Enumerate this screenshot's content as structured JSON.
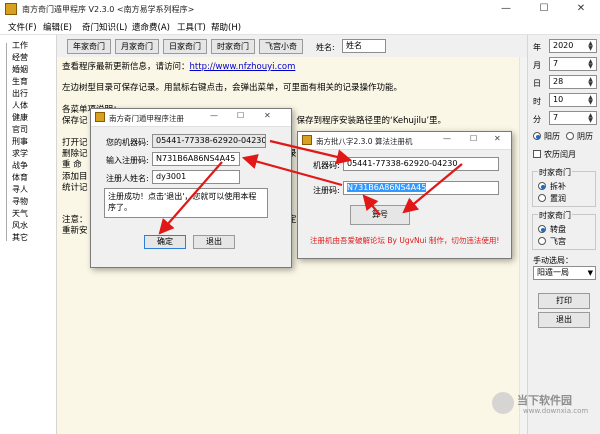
{
  "window": {
    "title": "南方奇门遁甲程序 V2.3.0   <南方易学系列程序>",
    "minimize": "—",
    "maximize": "☐",
    "close": "✕"
  },
  "menu": [
    "文件(F)",
    "编辑(E)",
    "奇门知识(L)",
    "遗命费(A)",
    "工具(T)",
    "帮助(H)"
  ],
  "toolbar": {
    "buttons": [
      "年家奇门",
      "月家奇门",
      "日家奇门",
      "时家奇门",
      "飞宫小奇"
    ],
    "name_label": "姓名:",
    "name_value": "姓名"
  },
  "tree": [
    "工作",
    "经营",
    "婚姻",
    "生育",
    "出行",
    "人体",
    "健康",
    "官司",
    "刑事",
    "求学",
    "战争",
    "体育",
    "寻人",
    "寻物",
    "天气",
    "风水",
    "其它"
  ],
  "content": {
    "line1_text": "查看程序最新更新信息，请访问：",
    "line1_link": "http://www.nfzhouyi.com",
    "line2": "左边树型目录可保存记录。用鼠标右键点击，会弹出菜单，可里面有相关的记录操作功能。",
    "line3": "各菜单项说明：",
    "line4a": "保存记",
    "line4b": "）保存到程序安装路径里的‘Kehujilu’里。",
    "line5": "打开记",
    "line6a": "删除记",
    "line6b": "录，",
    "line7": "重 命",
    "line8": "添加目",
    "line9": "统计记",
    "line10a": "注意：",
    "line10b": "定期",
    "line11a": "重新安",
    "line11b": "。"
  },
  "right_panel": {
    "year_label": "年",
    "year_value": "2020",
    "month_label": "月",
    "month_value": "7",
    "day_label": "日",
    "day_value": "28",
    "hour_label": "时",
    "hour_value": "10",
    "minute_label": "分",
    "minute_value": "7",
    "solar": "阳历",
    "lunar": "阴历",
    "leap_month": "农历闰月",
    "group1_title": "时家奇门",
    "group1_opt1": "拆补",
    "group1_opt2": "置润",
    "group2_title": "时家奇门",
    "group2_opt1": "转盘",
    "group2_opt2": "飞宫",
    "manual_label": "手动选局：",
    "manual_value": "阳遁一局",
    "print_button": "打印",
    "exit_button": "退出"
  },
  "register_dialog": {
    "title": "南方奇门遁甲程序注册",
    "machine_label": "您的机器码:",
    "machine_value": "05441-77338-62920-04230",
    "code_label": "输入注册码:",
    "code_value": "N731B6A86NS4A45",
    "name_label": "注册人姓名:",
    "name_value": "dy3001",
    "message": "注册成功！点击'退出'，您就可以使用本程序了。",
    "ok_button": "确定",
    "exit_button": "退出"
  },
  "keygen_dialog": {
    "title": "南方批八字2.3.0 算法注册机",
    "machine_label": "机器码:",
    "machine_value": "05441-77338-62920-04230",
    "code_label": "注册码:",
    "code_value": "N731B6A86NS4A45",
    "calc_button": "算号",
    "footer": "注册机由吾爱破解论坛 By UgvNui 制作，切勿违法使用!"
  },
  "watermark": {
    "brand": "当下软件园",
    "url": "www.downxia.com"
  },
  "colors": {
    "arrow": "#e01818",
    "link": "#0000cc",
    "footer_red": "#e01818",
    "selection": "#3399ff",
    "content_bg": "#fbf7e6"
  }
}
